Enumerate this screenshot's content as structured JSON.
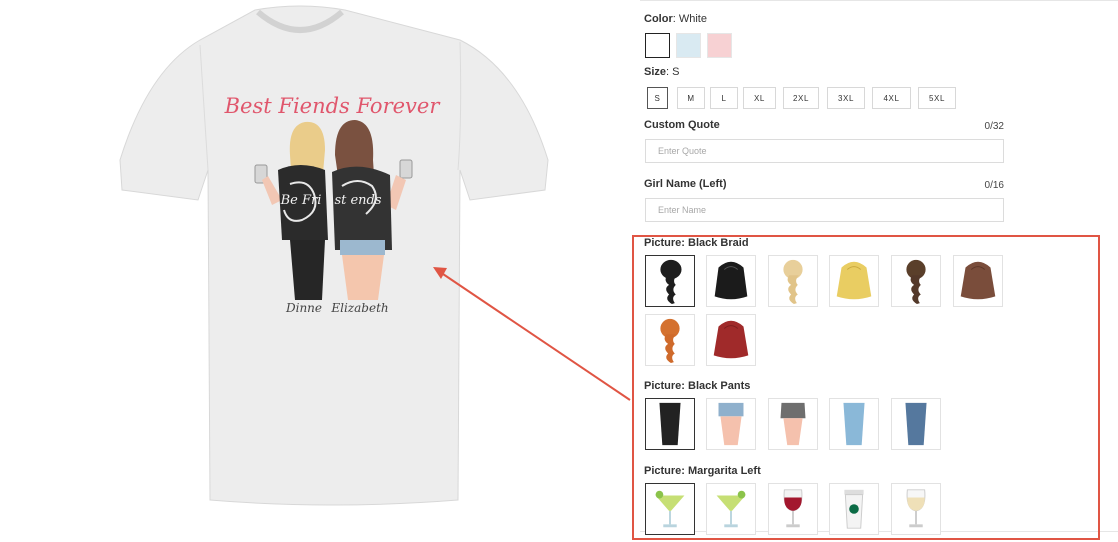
{
  "product": {
    "shirt_text": {
      "title": "Best Fiends Forever",
      "name_left": "Dinne",
      "name_right": "Elizabeth",
      "jacket_left": "Be Fri",
      "jacket_right": "st ends"
    }
  },
  "color": {
    "label": "Color",
    "value": "White",
    "swatches": [
      {
        "name": "White",
        "hex": "#ffffff"
      },
      {
        "name": "Light Blue",
        "hex": "#d9eaf2"
      },
      {
        "name": "Pink",
        "hex": "#f7d1d3"
      }
    ]
  },
  "size": {
    "label": "Size",
    "value": "S",
    "options": [
      "S",
      "M",
      "L",
      "XL",
      "2XL",
      "3XL",
      "4XL",
      "5XL"
    ]
  },
  "custom_quote": {
    "label": "Custom Quote",
    "counter": "0/32",
    "placeholder": "Enter Quote"
  },
  "girl_name": {
    "label": "Girl Name (Left)",
    "counter": "0/16",
    "placeholder": "Enter Name"
  },
  "hair": {
    "label": "Picture: Black Braid",
    "items": [
      "black-braid",
      "black-long",
      "blonde-braid",
      "blonde-long",
      "brown-braid",
      "brown-long",
      "red-braid",
      "red-long"
    ]
  },
  "pants": {
    "label": "Picture: Black Pants",
    "items": [
      "black-pants",
      "denim-shorts",
      "grey-skirt",
      "light-jeans",
      "dark-jeans"
    ]
  },
  "drink": {
    "label": "Picture: Margarita Left",
    "items": [
      "margarita-left",
      "margarita-right",
      "red-wine",
      "coffee-cup",
      "white-wine"
    ]
  },
  "colors": {
    "accent_red": "#e05544",
    "jacket": "#2b2b2b",
    "title_pink": "#e0566c"
  }
}
